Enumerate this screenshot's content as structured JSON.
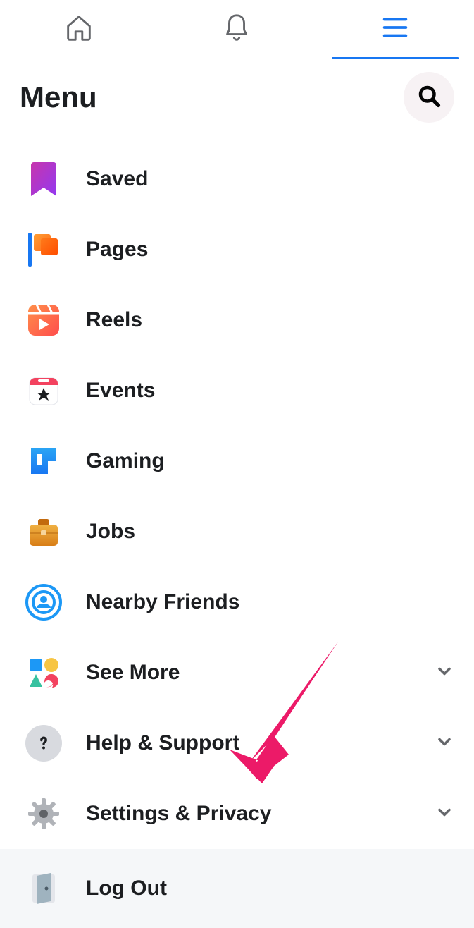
{
  "header": {
    "title": "Menu"
  },
  "menu": {
    "items": [
      {
        "label": "Saved",
        "expandable": false
      },
      {
        "label": "Pages",
        "expandable": false
      },
      {
        "label": "Reels",
        "expandable": false
      },
      {
        "label": "Events",
        "expandable": false
      },
      {
        "label": "Gaming",
        "expandable": false
      },
      {
        "label": "Jobs",
        "expandable": false
      },
      {
        "label": "Nearby Friends",
        "expandable": false
      },
      {
        "label": "See More",
        "expandable": true
      },
      {
        "label": "Help & Support",
        "expandable": true
      },
      {
        "label": "Settings & Privacy",
        "expandable": true
      },
      {
        "label": "Log Out",
        "expandable": false
      }
    ]
  },
  "colors": {
    "accent": "#1877f2",
    "arrow": "#ec1a68"
  }
}
